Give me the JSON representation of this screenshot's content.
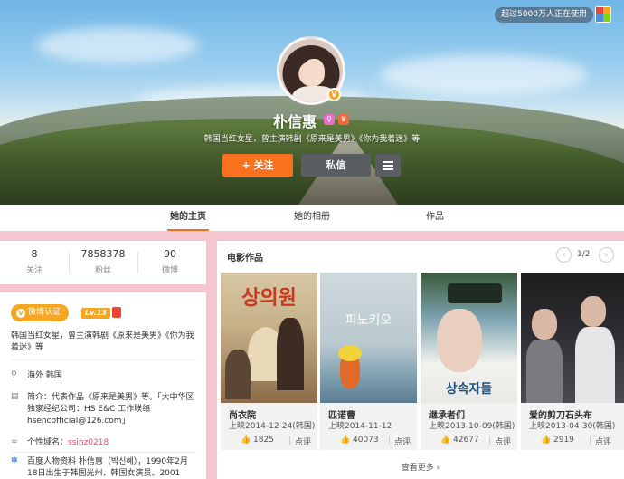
{
  "header": {
    "badge": "超过5000万人正在使用",
    "name": "朴信惠",
    "bio": "韩国当红女星，曾主演韩剧《原来是美男》《你为我着迷》等",
    "follow_label": "+ 关注",
    "message_label": "私信",
    "verified_mark": "V"
  },
  "tabs": [
    {
      "label": "她的主页",
      "active": true
    },
    {
      "label": "她的相册",
      "active": false
    },
    {
      "label": "作品",
      "active": false
    }
  ],
  "stats": [
    {
      "value": "8",
      "label": "关注"
    },
    {
      "value": "7858378",
      "label": "粉丝"
    },
    {
      "value": "90",
      "label": "微博"
    }
  ],
  "profile": {
    "verify_label": "微博认证",
    "level": "Lv.13",
    "desc": "韩国当红女星，曾主演韩剧《原来是美男》《你为我着迷》等",
    "location": "海外 韩国",
    "intro": "简介：代表作品《原来是美男》等。「大中华区独家经纪公司：HS E&C 工作联络hsencofficial@126.com」",
    "domain_label": "个性域名：",
    "domain_value": "ssinz0218",
    "baike": "百度人物资料 朴信惠（박신혜），1990年2月18日出生于韩国光州，韩国女演员。2001"
  },
  "films": {
    "title": "电影作品",
    "page": "1/2",
    "more": "查看更多 ›",
    "review_label": "点评",
    "items": [
      {
        "name": "尚衣院",
        "date": "上映2014-12-24(韩国)",
        "likes": "1825",
        "poster_text": "상의원"
      },
      {
        "name": "匹诺曹",
        "date": "上映2014-11-12",
        "likes": "40073",
        "poster_text": "피노키오"
      },
      {
        "name": "继承者们",
        "date": "上映2013-10-09(韩国)",
        "likes": "42677",
        "poster_text": "상속자들"
      },
      {
        "name": "爱的剪刀石头布",
        "date": "上映2013-04-30(韩国)",
        "likes": "2919",
        "poster_text": ""
      }
    ]
  }
}
